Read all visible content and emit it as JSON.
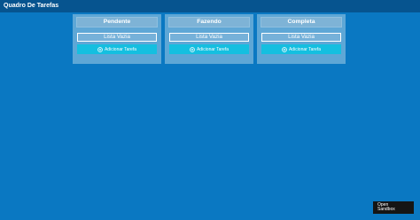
{
  "navbar": {
    "title": "Quadro De Tarefas"
  },
  "columns": [
    {
      "title": "Pendente",
      "empty_label": "Lista Vazia",
      "add_label": "Adicionar Tarefa"
    },
    {
      "title": "Fazendo",
      "empty_label": "Lista Vazia",
      "add_label": "Adicionar Tarefa"
    },
    {
      "title": "Completa",
      "empty_label": "Lista Vazia",
      "add_label": "Adicionar Tarefa"
    }
  ],
  "sandbox": {
    "line1": "Open",
    "line2": "Sandbox"
  },
  "icons": {
    "add": "plus-circle-icon"
  },
  "colors": {
    "background": "#0a78c2",
    "navbar": "#06548f",
    "column": "#5ea7d6",
    "accent": "#14bfe0"
  }
}
